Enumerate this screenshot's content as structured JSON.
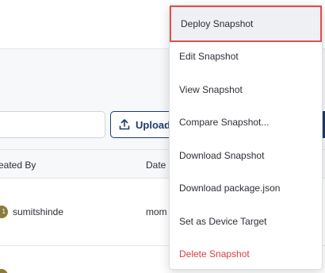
{
  "toolbar": {
    "upload_label": "Upload"
  },
  "table": {
    "headers": {
      "created_by": "eated By",
      "date": "Date"
    },
    "rows": [
      {
        "avatar_initial": "1",
        "user": "sumitshinde",
        "date": "mom"
      }
    ]
  },
  "menu": {
    "items": [
      {
        "label": "Deploy Snapshot",
        "highlighted": true
      },
      {
        "label": "Edit Snapshot"
      },
      {
        "label": "View Snapshot"
      },
      {
        "label": "Compare Snapshot..."
      },
      {
        "label": "Download Snapshot"
      },
      {
        "label": "Download package.json"
      },
      {
        "label": "Set as Device Target"
      },
      {
        "label": "Delete Snapshot",
        "danger": true
      }
    ]
  },
  "colors": {
    "primary": "#1f3a6b",
    "highlight_outline": "#e0504f",
    "danger_text": "#d64040"
  },
  "icons": {
    "upload": "upload-icon"
  }
}
